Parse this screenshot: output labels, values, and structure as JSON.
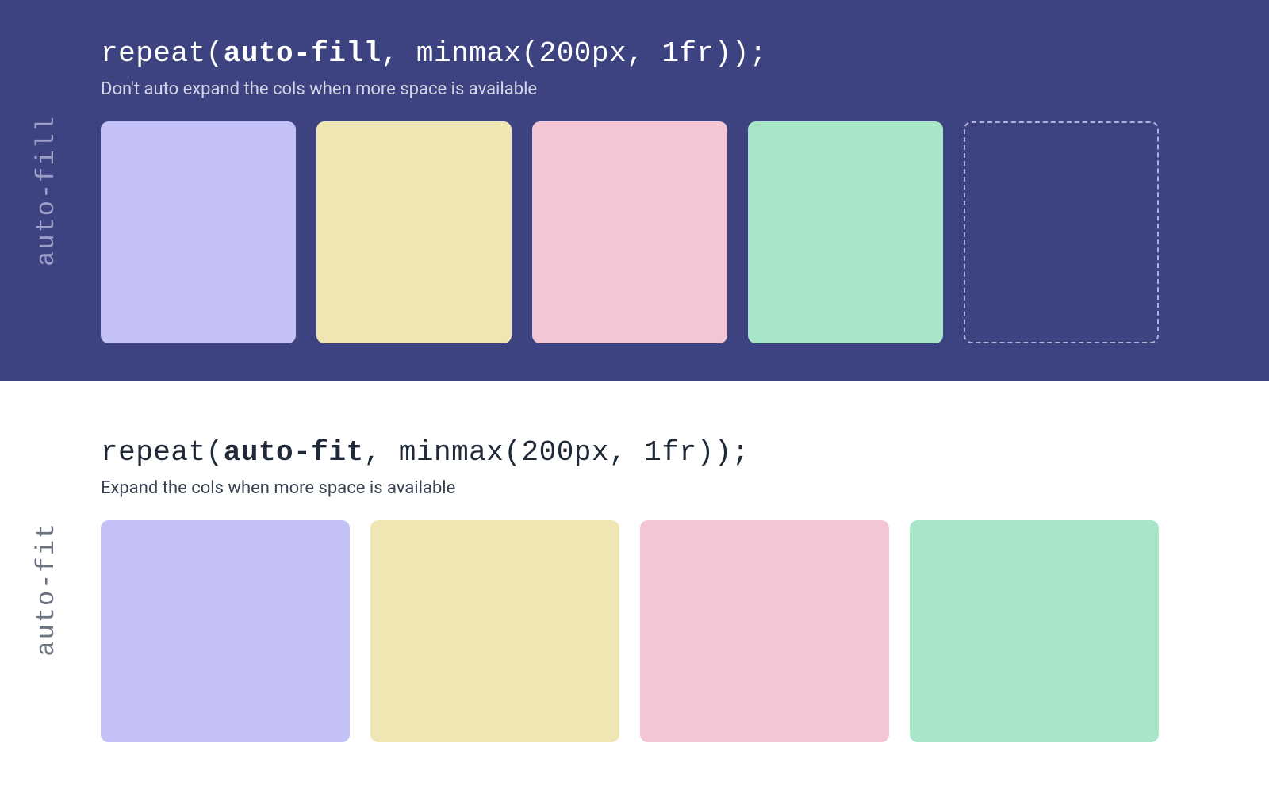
{
  "autoFill": {
    "sideLabel": "auto-fill",
    "codePrefix": "repeat(",
    "codeKeyword": "auto-fill",
    "codeSuffix": ", minmax(200px, 1fr));",
    "description": "Don't auto expand the cols when more space is available",
    "boxColors": [
      "purple",
      "yellow",
      "pink",
      "green"
    ],
    "hasEmptyTrack": true
  },
  "autoFit": {
    "sideLabel": "auto-fit",
    "codePrefix": "repeat(",
    "codeKeyword": "auto-fit",
    "codeSuffix": ", minmax(200px, 1fr));",
    "description": "Expand the cols when more space is available",
    "boxColors": [
      "purple",
      "yellow",
      "pink",
      "green"
    ],
    "hasEmptyTrack": false
  },
  "colors": {
    "darkBg": "#3d4280",
    "purple": "#c4c1f6",
    "yellow": "#f0e6b3",
    "pink": "#f3c5d5",
    "green": "#a9e6c8"
  }
}
